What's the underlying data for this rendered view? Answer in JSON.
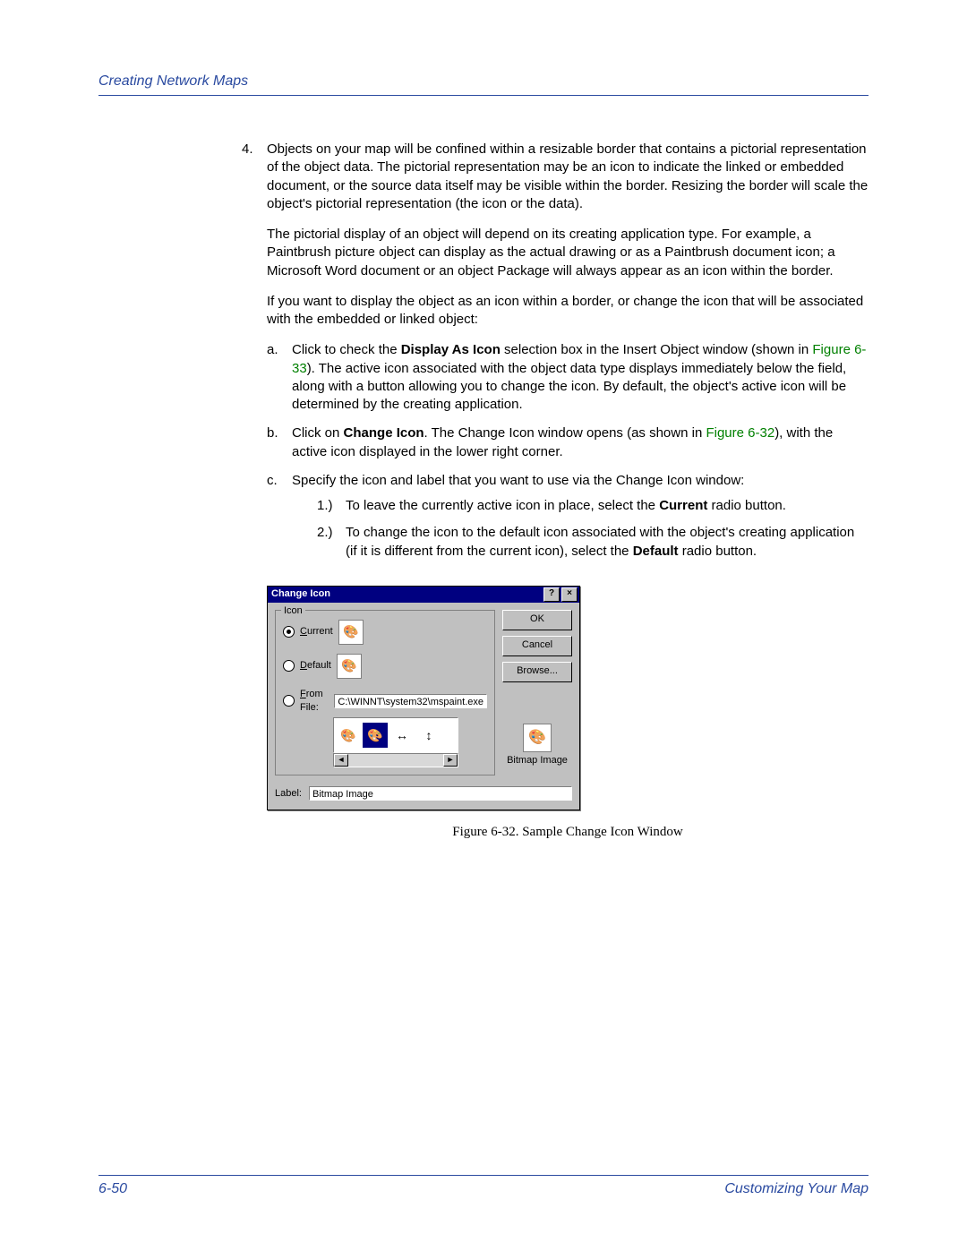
{
  "header": {
    "section_title": "Creating Network Maps"
  },
  "list": {
    "num4": "4.",
    "p4a": "Objects on your map will be confined within a resizable border that contains a pictorial representation of the object data. The pictorial representation may be an icon to indicate the linked or embedded document, or the source data itself may be visible within the border. Resizing the border will scale the object's pictorial representation (the icon or the data).",
    "p4b": "The pictorial display of an object will depend on its creating application type. For example, a Paintbrush picture object can display as the actual drawing or as a Paintbrush document icon; a Microsoft Word document or an object Package will always appear as an icon within the border.",
    "p4c": "If you want to display the object as an icon within a border, or change the icon that will be associated with the embedded or linked object:",
    "a_num": "a.",
    "a_pre": "Click to check the ",
    "a_bold1": "Display As Icon",
    "a_mid": " selection box in the Insert Object window (shown in ",
    "a_link": "Figure 6-33",
    "a_post": "). The active icon associated with the object data type displays immediately below the field, along with a button allowing you to change the icon. By default, the object's active icon will be determined by the creating application.",
    "b_num": "b.",
    "b_pre": "Click on ",
    "b_bold": "Change Icon",
    "b_mid": ". The Change Icon window opens (as shown in ",
    "b_link": "Figure 6-32",
    "b_post": "), with the active icon displayed in the lower right corner.",
    "c_num": "c.",
    "c_text": "Specify the icon and label that you want to use via the Change Icon window:",
    "c1_num": "1.)",
    "c1_pre": "To leave the currently active icon in place, select the ",
    "c1_bold": "Current",
    "c1_post": " radio button.",
    "c2_num": "2.)",
    "c2_pre": "To change the icon to the default icon associated with the object's creating application (if it is different from the current icon), select the ",
    "c2_bold": "Default",
    "c2_post": " radio button."
  },
  "dialog": {
    "title": "Change Icon",
    "help_glyph": "?",
    "close_glyph": "×",
    "group_label": "Icon",
    "radio_current_u": "C",
    "radio_current_rest": "urrent",
    "radio_default_u": "D",
    "radio_default_rest": "efault",
    "radio_fromfile_u": "F",
    "radio_fromfile_rest": "rom File:",
    "fromfile_value": "C:\\WINNT\\system32\\mspaint.exe",
    "ok": "OK",
    "cancel": "Cancel",
    "browse_u": "B",
    "browse_rest": "rowse...",
    "preview_caption": "Bitmap Image",
    "label_u": "L",
    "label_rest": "abel:",
    "label_value": "Bitmap Image",
    "scroll_left": "◄",
    "scroll_right": "►",
    "icon_glyph": "🎨",
    "arrow_h": "↔",
    "arrow_v": "↕"
  },
  "figure_caption": "Figure 6-32. Sample Change Icon Window",
  "footer": {
    "page_no": "6-50",
    "section": "Customizing Your Map"
  }
}
